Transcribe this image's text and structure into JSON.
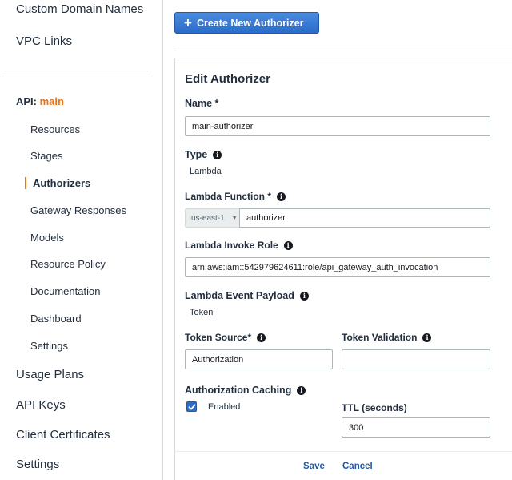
{
  "sidebar": {
    "top_items": [
      "Custom Domain Names",
      "VPC Links"
    ],
    "api_prefix": "API:",
    "api_name": "main",
    "sub_items": [
      "Resources",
      "Stages",
      "Authorizers",
      "Gateway Responses",
      "Models",
      "Resource Policy",
      "Documentation",
      "Dashboard",
      "Settings"
    ],
    "active_item": "Authorizers",
    "bottom_items": [
      "Usage Plans",
      "API Keys",
      "Client Certificates",
      "Settings"
    ]
  },
  "toolbar": {
    "create_label": "Create New Authorizer"
  },
  "form": {
    "title": "Edit Authorizer",
    "name_label": "Name *",
    "name_value": "main-authorizer",
    "type_label": "Type",
    "type_value": "Lambda",
    "lambda_function_label": "Lambda Function *",
    "region_value": "us-east-1",
    "function_value": "authorizer",
    "invoke_role_label": "Lambda Invoke Role",
    "invoke_role_value": "arn:aws:iam::542979624611:role/api_gateway_auth_invocation",
    "event_payload_label": "Lambda Event Payload",
    "event_payload_value": "Token",
    "token_source_label": "Token Source*",
    "token_source_value": "Authorization",
    "token_validation_label": "Token Validation",
    "token_validation_value": "",
    "caching_label": "Authorization Caching",
    "caching_enabled_label": "Enabled",
    "caching_enabled": true,
    "ttl_label": "TTL (seconds)",
    "ttl_value": "300",
    "save_label": "Save",
    "cancel_label": "Cancel"
  },
  "colors": {
    "accent_orange": "#ec7211",
    "primary_blue": "#2b6cc9",
    "link_blue": "#1e5aa8"
  }
}
